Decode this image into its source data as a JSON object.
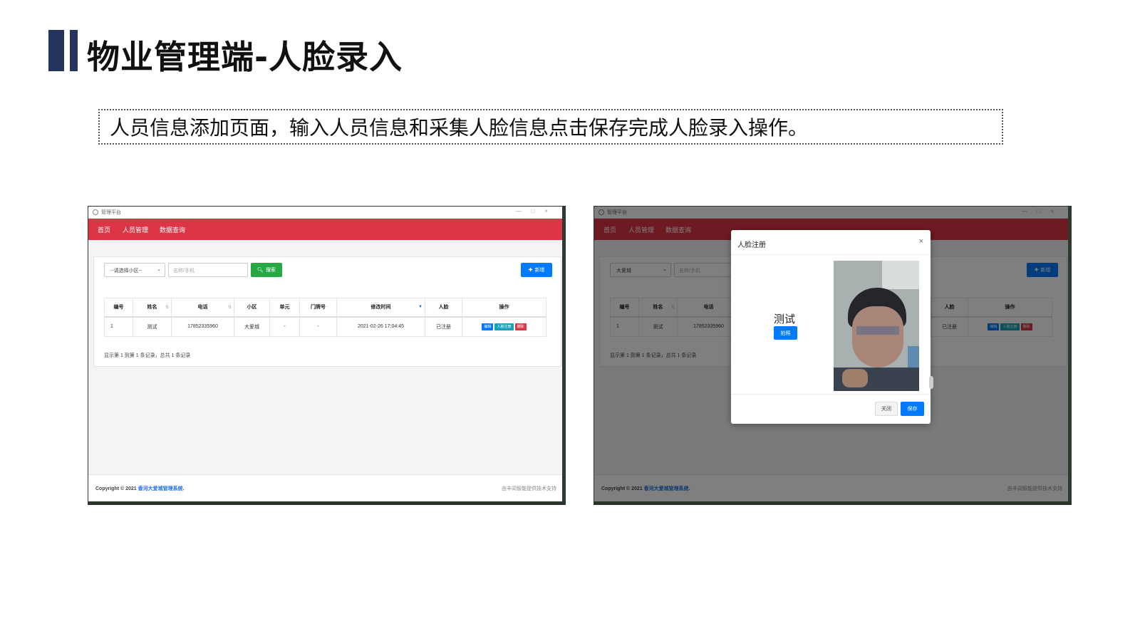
{
  "slide": {
    "title": "物业管理端-人脸录入",
    "description": "人员信息添加页面，输入人员信息和采集人脸信息点击保存完成人脸录入操作。"
  },
  "colors": {
    "title_bar": "#25345c",
    "navbar": "#dc3545",
    "primary": "#007bff",
    "success": "#28a745",
    "info": "#17a2b8",
    "danger": "#dc3545"
  },
  "window": {
    "title": "管理平台",
    "controls": [
      "—",
      "□",
      "×"
    ]
  },
  "nav": {
    "items": [
      "首页",
      "人员管理",
      "数据查询"
    ]
  },
  "filters": {
    "community_select_left": "--请选择小区--",
    "community_select_right": "大爱城",
    "search_placeholder": "名称/手机",
    "search_button": "搜索",
    "add_button": "新增"
  },
  "table": {
    "columns": [
      "编号",
      "姓名",
      "电话",
      "小区",
      "单元",
      "门牌号",
      "修改时间",
      "人脸",
      "操作"
    ],
    "rows": [
      {
        "id": "1",
        "name": "测试",
        "phone": "17852335960",
        "community": "大爱城",
        "unit": "-",
        "door": "-",
        "updated": "2021-02-26 17:04:45",
        "face": "已注册",
        "actions": [
          "编辑",
          "人脸注册",
          "删除"
        ]
      }
    ],
    "summary": "显示第 1 到第 1 条记录，总共 1 条记录"
  },
  "footer": {
    "copyright_prefix": "Copyright © 2021",
    "copyright_link": "香河大爱城管理系统",
    "copyright_suffix": ".",
    "support": "由丰闾智能提供技术支持"
  },
  "modal": {
    "title": "人脸注册",
    "close_icon": "×",
    "person_name": "测试",
    "capture_button": "拍照",
    "close_button": "关闭",
    "save_button": "保存"
  },
  "icons": {
    "search": "search-icon",
    "add": "plus-icon",
    "close": "close-icon",
    "dropdown": "chevron-down-icon",
    "sort": "sort-icon"
  }
}
